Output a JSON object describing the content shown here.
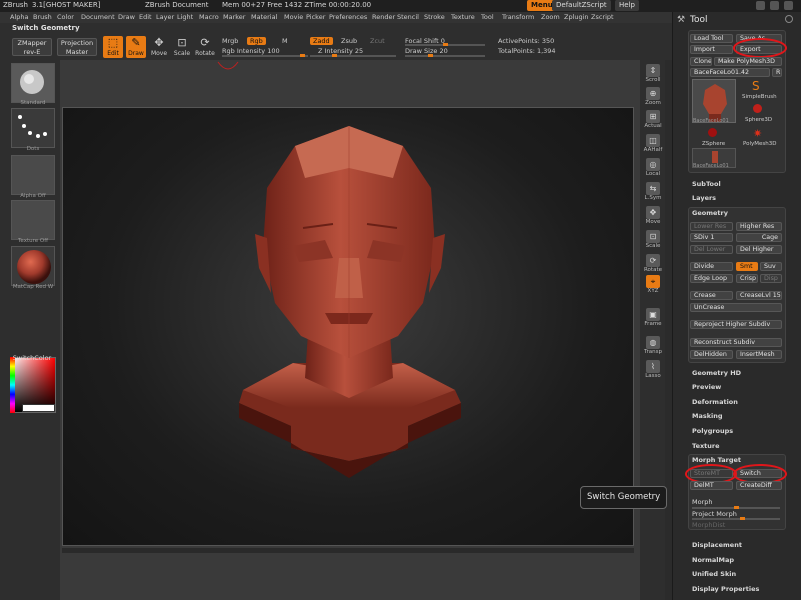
{
  "titlebar": {
    "app": "ZBrush",
    "version": "3.1[GHOST MAKER]",
    "document": "ZBrush Document",
    "mem": "Mem 00+27 Free 1432 ZTime 00:00:20.00",
    "menus_btn": "Menus",
    "script": "DefaultZScript",
    "help": "Help"
  },
  "menubar": [
    "Alpha",
    "Brush",
    "Color",
    "Document",
    "Draw",
    "Edit",
    "Layer",
    "Light",
    "Macro",
    "Marker",
    "Material",
    "Movie",
    "Picker",
    "Preferences",
    "Render",
    "Stencil",
    "Stroke",
    "Texture",
    "Tool",
    "Transform",
    "Zoom",
    "Zplugin",
    "Zscript"
  ],
  "row2": {
    "title": "Switch Geometry"
  },
  "toolbar": {
    "zmapper": "ZMapper",
    "zmapper_sub": "rev-E",
    "projection": "Projection",
    "projection_sub": "Master",
    "edit": "Edit",
    "draw": "Draw",
    "move": "Move",
    "scale": "Scale",
    "rotate": "Rotate",
    "mrgb": "Mrgb",
    "rgb": "Rgb",
    "m": "M",
    "rgb_intensity": "Rgb Intensity 100",
    "zadd": "Zadd",
    "zsub": "Zsub",
    "zcut": "Zcut",
    "z_intensity": "Z Intensity 25",
    "focal_shift": "Focal Shift 0",
    "draw_size": "Draw Size 20",
    "active_points": "ActivePoints: 350",
    "total_points": "TotalPoints: 1,394"
  },
  "leftshelf": {
    "standard": "Standard",
    "dots": "Dots",
    "alpha_off": "Alpha Off",
    "texture_off": "Texture Off",
    "material": "MatCap Red W",
    "switch_color": "SwitchColor"
  },
  "rightshelf": [
    "Scroll",
    "Zoom",
    "Actual",
    "AAHalf",
    "Local",
    "L.Sym",
    "Move",
    "Scale",
    "Rotate",
    "XYZ",
    "Frame",
    "Transp",
    "Lasso"
  ],
  "tool": {
    "title": "Tool",
    "load_tool": "Load Tool",
    "save_as": "Save As",
    "import": "Import",
    "export": "Export",
    "clone": "Clone",
    "make_polymesh": "Make PolyMesh3D",
    "current_tool": "BaceFaceLo01.42",
    "r_btn": "R",
    "simple_brush": "SimpleBrush",
    "sphere3d": "Sphere3D",
    "zsphere": "ZSphere",
    "polymesh3d": "PolyMesh3D",
    "thumb1_label": "BaceFaceLo01",
    "thumb2_label": "BaceFaceLo01"
  },
  "sections": {
    "subtool": "SubTool",
    "layers": "Layers",
    "geometry": "Geometry",
    "geometry_hd": "Geometry HD",
    "preview": "Preview",
    "deformation": "Deformation",
    "masking": "Masking",
    "polygroups": "Polygroups",
    "texture": "Texture",
    "morph_target": "Morph Target",
    "displacement": "Displacement",
    "normalmap": "NormalMap",
    "unified_skin": "Unified Skin",
    "display_properties": "Display Properties"
  },
  "geometry": {
    "lower_res": "Lower Res",
    "higher_res": "Higher Res",
    "sdiv": "SDiv 1",
    "cage": "Cage",
    "del_lower": "Del Lower",
    "del_higher": "Del Higher",
    "divide": "Divide",
    "smt": "Smt",
    "suv": "Suv",
    "edge_loop": "Edge Loop",
    "crisp": "Crisp",
    "disp": "Disp",
    "crease": "Crease",
    "crease_lvl": "CreaseLvl 15",
    "uncrease": "UnCrease",
    "reproject": "Reproject Higher Subdiv",
    "reconstruct": "Reconstruct Subdiv",
    "delhidden": "DelHidden",
    "insertmesh": "InsertMesh"
  },
  "morph": {
    "storemt": "StoreMT",
    "switch": "Switch",
    "delmt": "DelMT",
    "creatediff": "CreateDiff",
    "morph": "Morph",
    "project_morph": "Project Morph",
    "morph_dist": "MorphDist"
  },
  "tooltip": "Switch Geometry",
  "colors": {
    "accent": "#e87b14",
    "highlight": "#e0161a",
    "clay": "#a03a2c"
  }
}
